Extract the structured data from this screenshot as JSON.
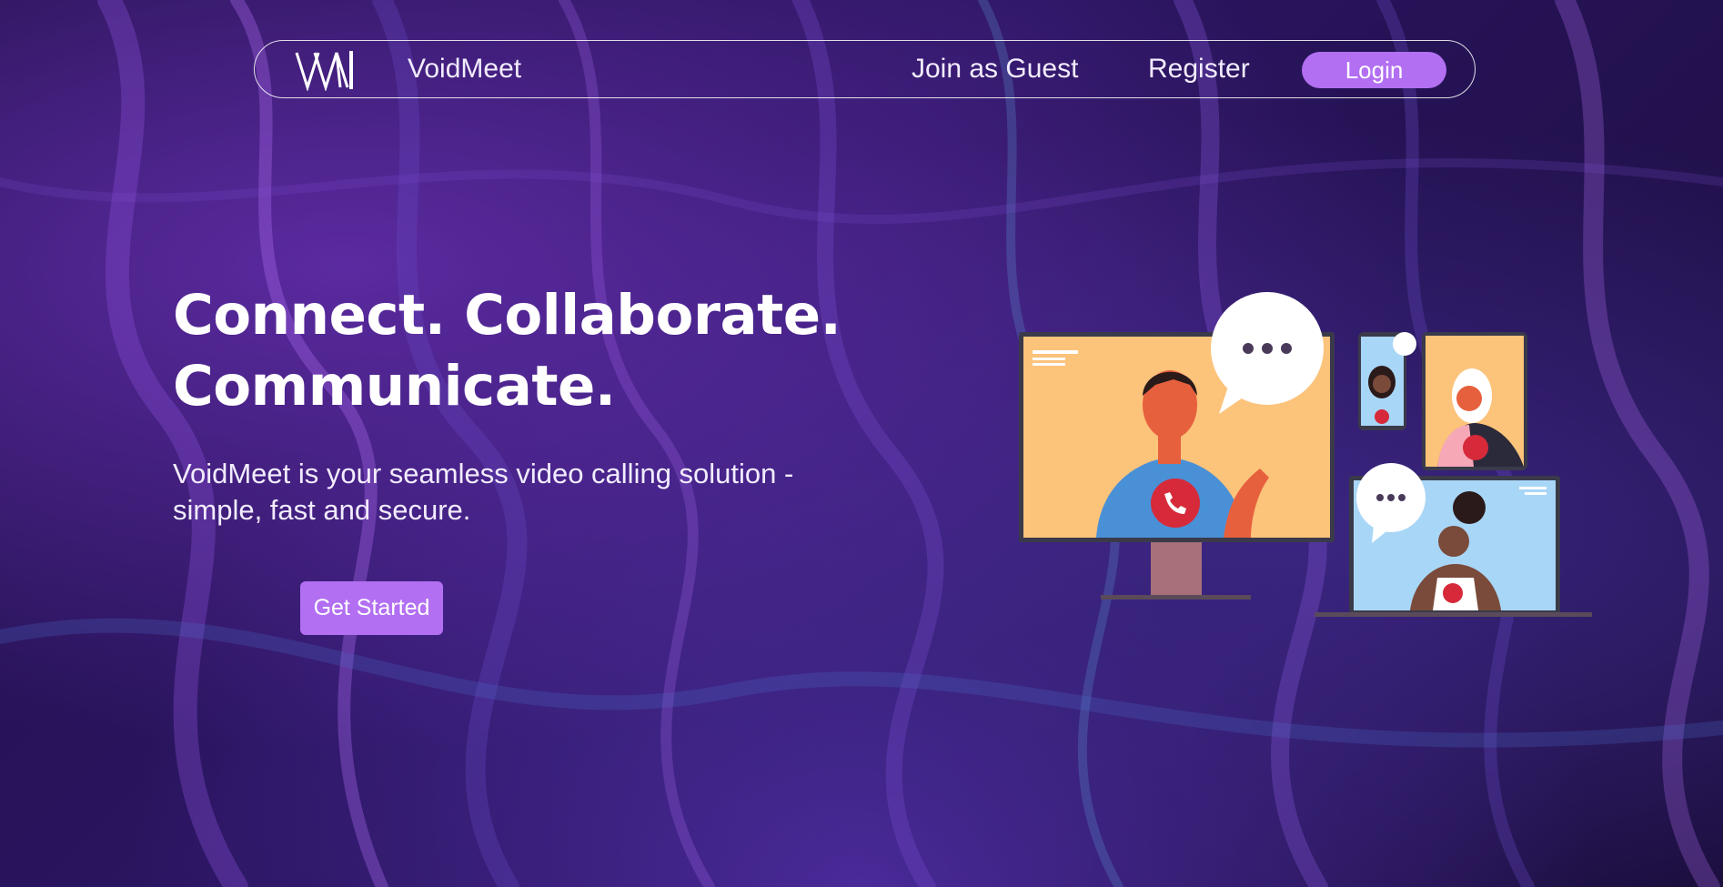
{
  "nav": {
    "brand": "VoidMeet",
    "logo_letters": "VM",
    "guest_label": "Join as Guest",
    "register_label": "Register",
    "login_label": "Login"
  },
  "hero": {
    "title_line1": "Connect. Collaborate.",
    "title_line2": "Communicate.",
    "subtitle_line1": "VoidMeet is your seamless video calling solution -",
    "subtitle_line2": "simple, fast and secure.",
    "cta_label": "Get Started"
  },
  "illustration": {
    "chat_bubble_text": "•••"
  },
  "colors": {
    "accent": "#b26ff2",
    "bg_dark": "#1e0f45",
    "call_red": "#d62a3a"
  }
}
